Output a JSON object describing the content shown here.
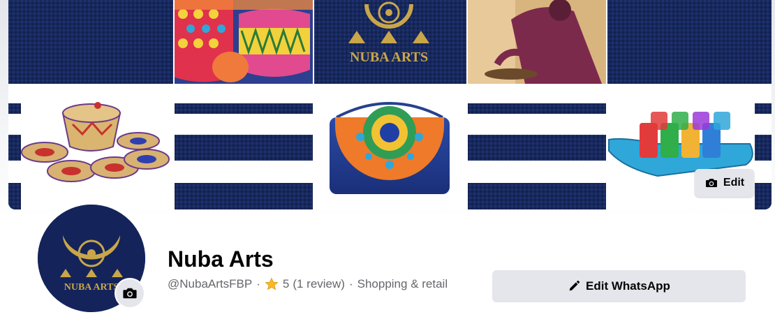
{
  "cover": {
    "edit_label": "Edit",
    "logo_text": "NUBA ARTS"
  },
  "profile": {
    "name": "Nuba Arts",
    "handle": "@NubaArtsFBP",
    "separator": "·",
    "rating": "5",
    "reviews": "(1 review)",
    "category": "Shopping & retail",
    "logo_text": "NUBA ARTS"
  },
  "actions": {
    "edit_whatsapp_label": "Edit WhatsApp"
  },
  "colors": {
    "navy": "#17285c",
    "gold": "#c9a64a",
    "button_bg": "#e4e6eb",
    "star": "#f7b928",
    "secondary_text": "#65676b"
  }
}
